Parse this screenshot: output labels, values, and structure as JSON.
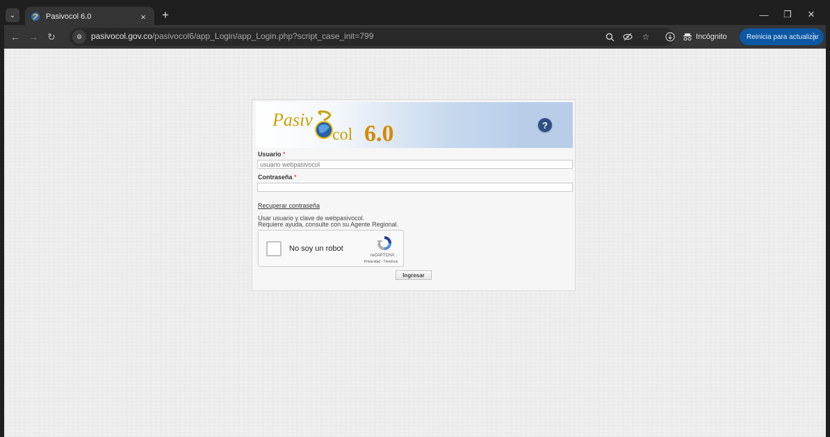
{
  "browser": {
    "tab": {
      "title": "Pasivocol 6.0",
      "close_glyph": "×"
    },
    "new_tab_glyph": "+",
    "url_host": "pasivocol.gov.co",
    "url_path": "/pasivocol6/app_Login/app_Login.php?script_case_init=799",
    "incognito_label": "Incógnito",
    "restart_label": "Reinicia para actualizar",
    "accent_color": "#0b57a3"
  },
  "login": {
    "logo_text_1": "Pasiv",
    "logo_text_2": "col",
    "logo_version": "6.0",
    "help_glyph": "?",
    "username_label": "Usuario",
    "required_mark": "*",
    "username_placeholder": "usuario webpasivocol",
    "password_label": "Contraseña",
    "recover_link": "Recuperar contraseña",
    "info_line_1": "Usar usuario y clave de webpasivocol.",
    "info_line_2": "Requiere ayuda, consulte con su Agente Regional.",
    "captcha": {
      "label": "No soy un robot",
      "brand": "reCAPTCHA",
      "terms": "Privacidad - Términos"
    },
    "submit_label": "Ingresar"
  }
}
